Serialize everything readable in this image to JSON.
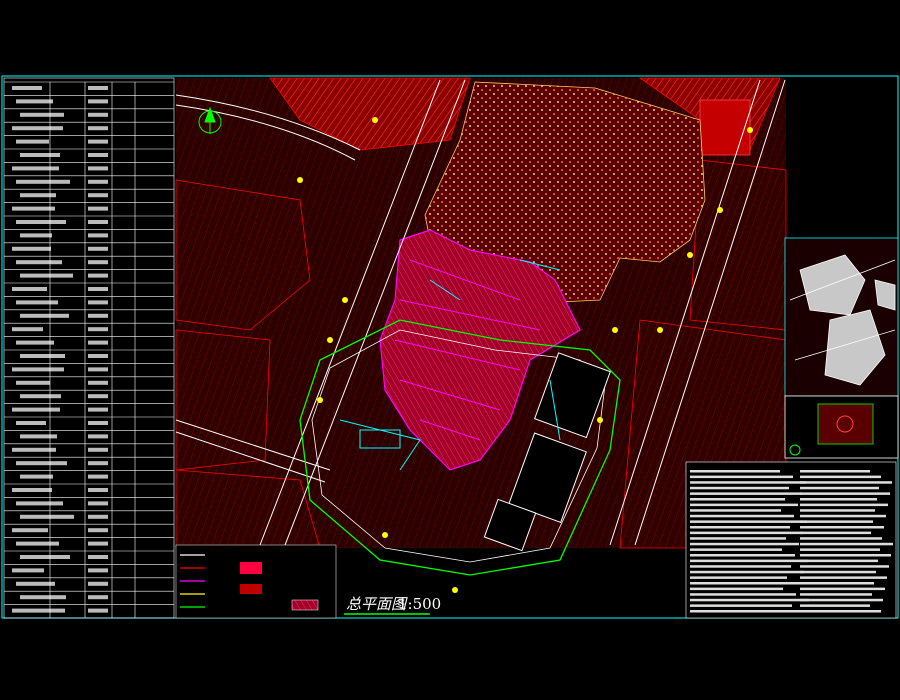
{
  "drawing": {
    "title": "总平面图",
    "scale": "1:500"
  },
  "colors": {
    "background": "#000000",
    "frame": "#00ffff",
    "site_fill": "#ff0000",
    "building": "#ff00ff",
    "green": "#00ff00",
    "yellow": "#ffff00",
    "white": "#ffffff",
    "road": "#ffffff"
  }
}
